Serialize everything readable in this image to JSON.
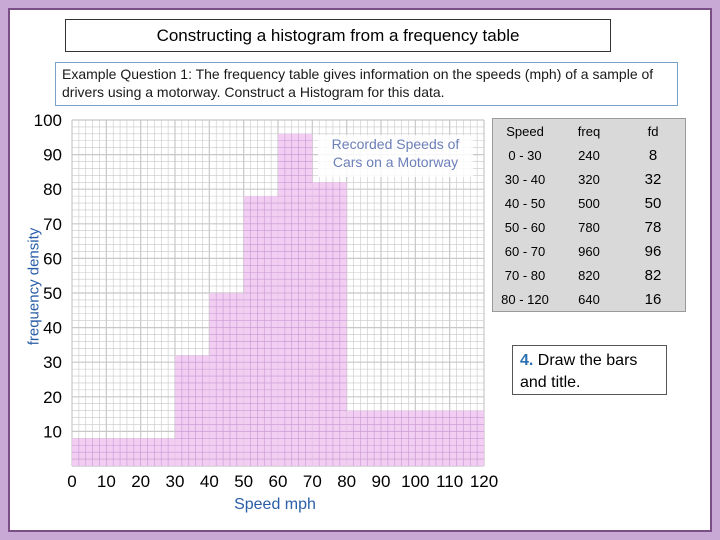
{
  "header": {
    "title": "Constructing a histogram from a frequency table",
    "question": "Example Question 1: The frequency table gives information on the speeds (mph) of a sample of drivers using a motorway. Construct a Histogram for this data."
  },
  "table": {
    "headers": [
      "Speed",
      "freq",
      "fd"
    ],
    "rows": [
      [
        "0 - 30",
        "240",
        "8"
      ],
      [
        "30 - 40",
        "320",
        "32"
      ],
      [
        "40 - 50",
        "500",
        "50"
      ],
      [
        "50 - 60",
        "780",
        "78"
      ],
      [
        "60 - 70",
        "960",
        "96"
      ],
      [
        "70 - 80",
        "820",
        "82"
      ],
      [
        "80 - 120",
        "640",
        "16"
      ]
    ]
  },
  "task": {
    "number": "4.",
    "text": "Draw the bars and title."
  },
  "colors": {
    "bar_fill": "#f0c6f0",
    "bar_grid": "#c99ad6",
    "grid": "#c8c8c8",
    "axis_title": "#2a5ea8",
    "frame": "#c8a8d4"
  },
  "chart_data": {
    "type": "bar",
    "title": "Recorded Speeds of Cars on a Motorway",
    "xlabel": "Speed mph",
    "ylabel": "frequency density",
    "xlim": [
      0,
      120
    ],
    "ylim": [
      0,
      100
    ],
    "x_ticks": [
      "0",
      "10",
      "20",
      "30",
      "40",
      "50",
      "60",
      "70",
      "80",
      "90",
      "100",
      "110",
      "120"
    ],
    "y_ticks": [
      "10",
      "20",
      "30",
      "40",
      "50",
      "60",
      "70",
      "80",
      "90",
      "100"
    ],
    "bins": [
      {
        "from": 0,
        "to": 30,
        "value": 8
      },
      {
        "from": 30,
        "to": 40,
        "value": 32
      },
      {
        "from": 40,
        "to": 50,
        "value": 50
      },
      {
        "from": 50,
        "to": 60,
        "value": 78
      },
      {
        "from": 60,
        "to": 70,
        "value": 96
      },
      {
        "from": 70,
        "to": 80,
        "value": 82
      },
      {
        "from": 80,
        "to": 120,
        "value": 16
      }
    ],
    "grid": true
  }
}
